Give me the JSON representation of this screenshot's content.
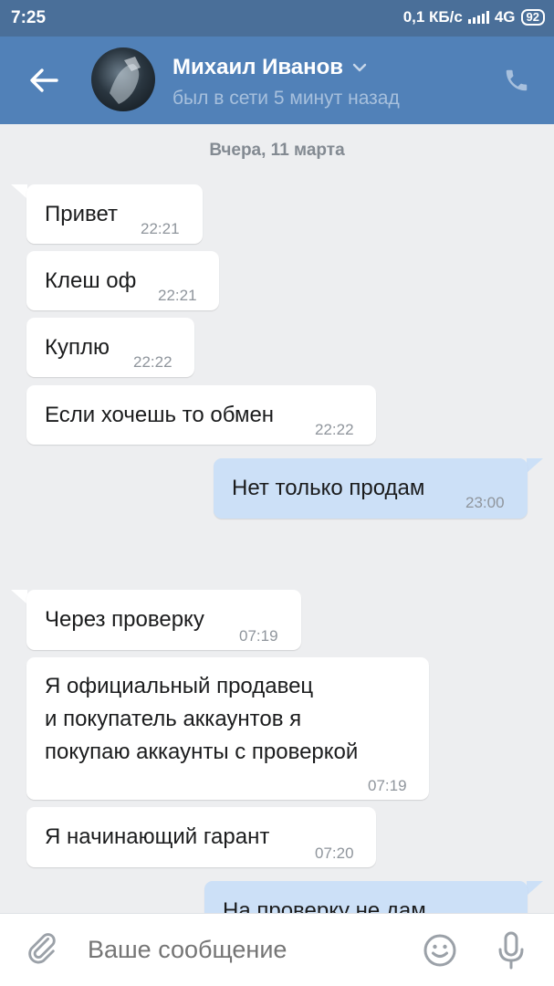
{
  "status_bar": {
    "time": "7:25",
    "speed": "0,1 КБ/с",
    "network": "4G",
    "battery": "92"
  },
  "header": {
    "name": "Михаил Иванов",
    "status": "был в сети 5 минут назад",
    "back_icon": "back-arrow-icon",
    "call_icon": "phone-icon"
  },
  "chat": {
    "date": "Вчера, 11 марта",
    "messages": [
      {
        "dir": "in",
        "text": "Привет",
        "time": "22:21"
      },
      {
        "dir": "in",
        "text": "Клеш оф",
        "time": "22:21"
      },
      {
        "dir": "in",
        "text": "Куплю",
        "time": "22:22"
      },
      {
        "dir": "in",
        "text": "Если хочешь то обмен",
        "time": "22:22"
      },
      {
        "dir": "out",
        "text": "Нет только продам",
        "time": "23:00"
      },
      {
        "dir": "in",
        "text": "Через проверку",
        "time": "07:19"
      },
      {
        "dir": "in",
        "text_lines": [
          "Я официальный продавец",
          "и покупатель аккаунтов я",
          "покупаю аккаунты с проверкой"
        ],
        "time": "07:19"
      },
      {
        "dir": "in",
        "text": "Я начинающий гарант",
        "time": "07:20"
      },
      {
        "dir": "out",
        "text": "На проверку не дам",
        "time": ""
      }
    ]
  },
  "input": {
    "placeholder": "Ваше сообщение"
  },
  "colors": {
    "header": "#5181b8",
    "status_bar": "#4a6f99",
    "background": "#edeef0",
    "outgoing_bubble": "#cce0f7",
    "incoming_bubble": "#ffffff"
  }
}
